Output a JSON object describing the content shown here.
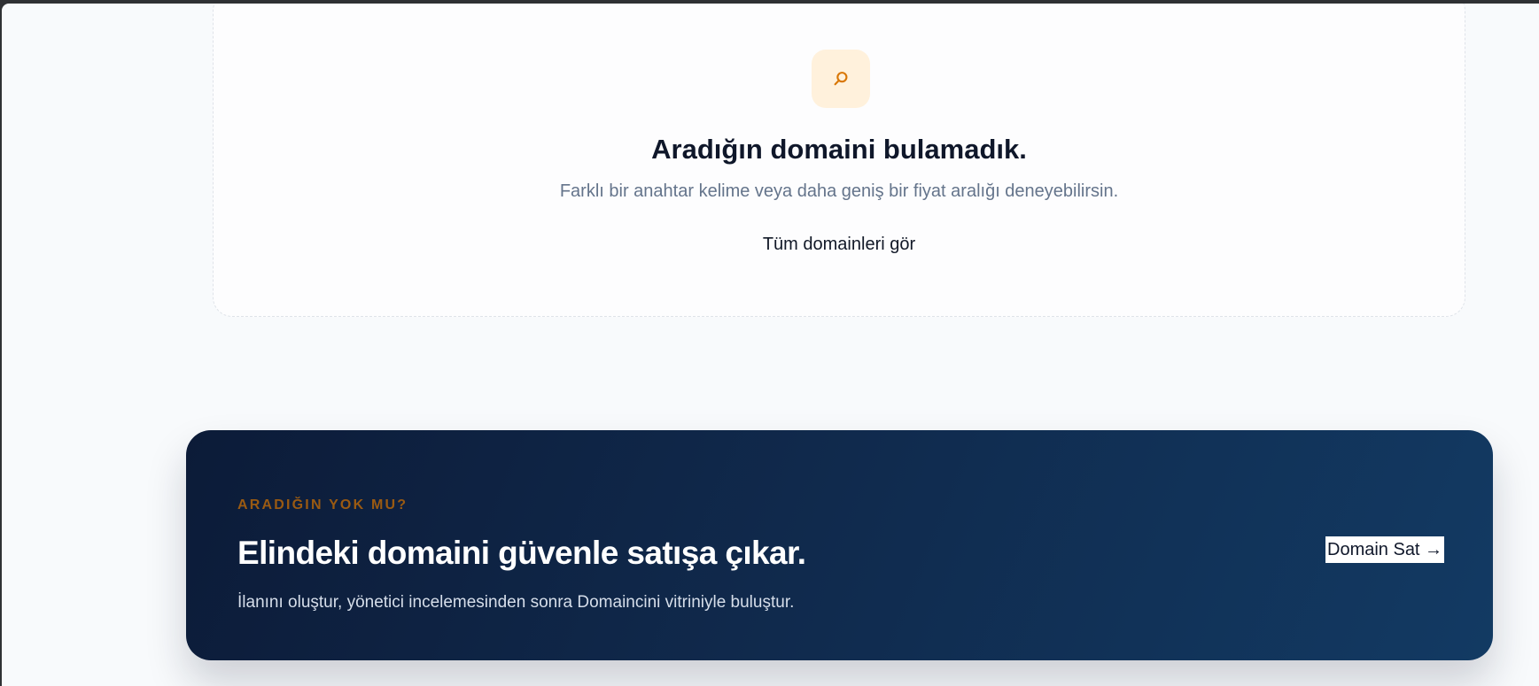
{
  "empty_state": {
    "icon": "search-icon",
    "title": "Aradığın domaini bulamadık.",
    "subtitle": "Farklı bir anahtar kelime veya daha geniş bir fiyat aralığı deneyebilirsin.",
    "link_label": "Tüm domainleri gör"
  },
  "cta": {
    "eyebrow": "ARADIĞIN YOK MU?",
    "title": "Elindeki domaini güvenle satışa çıkar.",
    "description": "İlanını oluştur, yönetici incelemesinden sonra Domaincini vitriniyle buluştur.",
    "button_label": "Domain Sat →"
  },
  "colors": {
    "icon_accent": "#d97706",
    "icon_background": "#fff1dc",
    "banner_start": "#0c1b38",
    "banner_end": "#123a63",
    "eyebrow": "#9a5a12"
  }
}
